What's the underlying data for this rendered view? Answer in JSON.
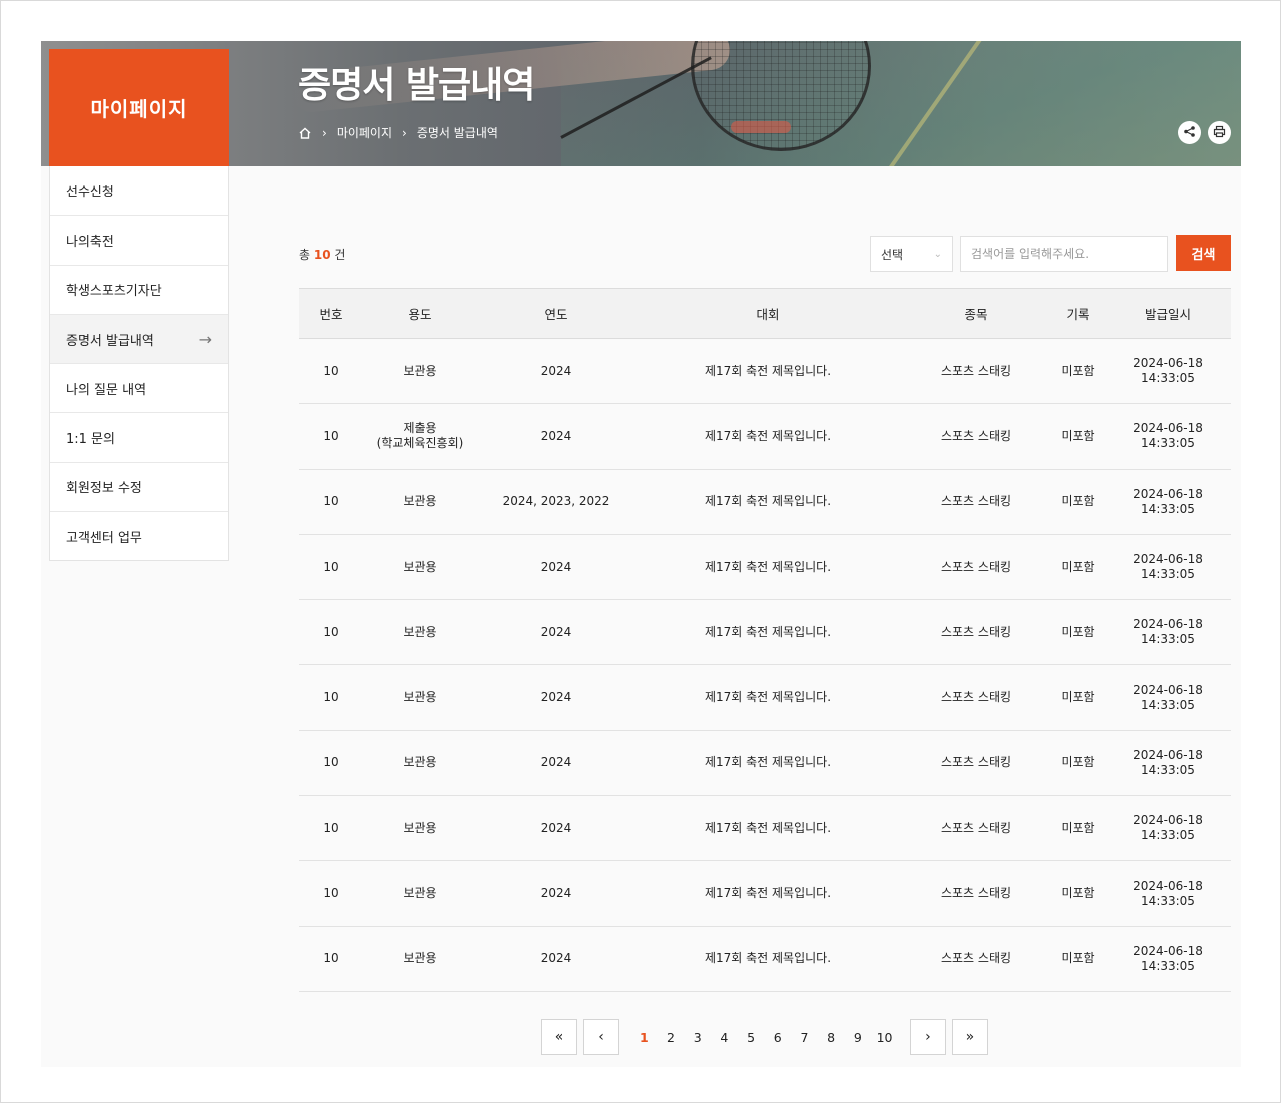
{
  "header": {
    "section_label": "마이페이지",
    "page_title": "증명서 발급내역",
    "breadcrumb": [
      "마이페이지",
      "증명서 발급내역"
    ],
    "share_icon": "share-icon",
    "print_icon": "print-icon",
    "accent_color": "#e8521f"
  },
  "sidebar": {
    "items": [
      {
        "label": "선수신청"
      },
      {
        "label": "나의축전"
      },
      {
        "label": "학생스포츠기자단"
      },
      {
        "label": "증명서 발급내역",
        "active": true
      },
      {
        "label": "나의 질문 내역"
      },
      {
        "label": "1:1 문의"
      },
      {
        "label": "회원정보 수정"
      },
      {
        "label": "고객센터 업무"
      }
    ]
  },
  "toolbar": {
    "total_prefix": "총",
    "total_count": "10",
    "total_suffix": "건",
    "select_value": "선택",
    "search_placeholder": "검색어를 입력해주세요.",
    "search_button": "검색"
  },
  "table": {
    "headers": [
      "번호",
      "용도",
      "연도",
      "대회",
      "종목",
      "기록",
      "발급일시"
    ],
    "rows": [
      {
        "no": "10",
        "purpose": "보관용",
        "purpose2": "",
        "year": "2024",
        "event": "제17회 축전 제목입니다.",
        "sport": "스포츠 스태킹",
        "record": "미포함",
        "date": "2024-06-18",
        "time": "14:33:05"
      },
      {
        "no": "10",
        "purpose": "제출용",
        "purpose2": "(학교체육진흥회)",
        "year": "2024",
        "event": "제17회 축전 제목입니다.",
        "sport": "스포츠 스태킹",
        "record": "미포함",
        "date": "2024-06-18",
        "time": "14:33:05"
      },
      {
        "no": "10",
        "purpose": "보관용",
        "purpose2": "",
        "year": "2024, 2023, 2022",
        "event": "제17회 축전 제목입니다.",
        "sport": "스포츠 스태킹",
        "record": "미포함",
        "date": "2024-06-18",
        "time": "14:33:05"
      },
      {
        "no": "10",
        "purpose": "보관용",
        "purpose2": "",
        "year": "2024",
        "event": "제17회 축전 제목입니다.",
        "sport": "스포츠 스태킹",
        "record": "미포함",
        "date": "2024-06-18",
        "time": "14:33:05"
      },
      {
        "no": "10",
        "purpose": "보관용",
        "purpose2": "",
        "year": "2024",
        "event": "제17회 축전 제목입니다.",
        "sport": "스포츠 스태킹",
        "record": "미포함",
        "date": "2024-06-18",
        "time": "14:33:05"
      },
      {
        "no": "10",
        "purpose": "보관용",
        "purpose2": "",
        "year": "2024",
        "event": "제17회 축전 제목입니다.",
        "sport": "스포츠 스태킹",
        "record": "미포함",
        "date": "2024-06-18",
        "time": "14:33:05"
      },
      {
        "no": "10",
        "purpose": "보관용",
        "purpose2": "",
        "year": "2024",
        "event": "제17회 축전 제목입니다.",
        "sport": "스포츠 스태킹",
        "record": "미포함",
        "date": "2024-06-18",
        "time": "14:33:05"
      },
      {
        "no": "10",
        "purpose": "보관용",
        "purpose2": "",
        "year": "2024",
        "event": "제17회 축전 제목입니다.",
        "sport": "스포츠 스태킹",
        "record": "미포함",
        "date": "2024-06-18",
        "time": "14:33:05"
      },
      {
        "no": "10",
        "purpose": "보관용",
        "purpose2": "",
        "year": "2024",
        "event": "제17회 축전 제목입니다.",
        "sport": "스포츠 스태킹",
        "record": "미포함",
        "date": "2024-06-18",
        "time": "14:33:05"
      },
      {
        "no": "10",
        "purpose": "보관용",
        "purpose2": "",
        "year": "2024",
        "event": "제17회 축전 제목입니다.",
        "sport": "스포츠 스태킹",
        "record": "미포함",
        "date": "2024-06-18",
        "time": "14:33:05"
      }
    ]
  },
  "pagination": {
    "first": "«",
    "prev": "‹",
    "pages": [
      "1",
      "2",
      "3",
      "4",
      "5",
      "6",
      "7",
      "8",
      "9",
      "10"
    ],
    "current": "1",
    "next": "›",
    "last": "»"
  }
}
